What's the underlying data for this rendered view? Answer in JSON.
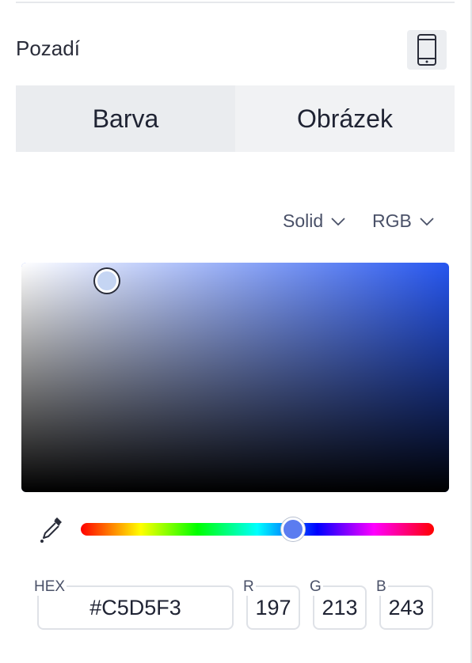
{
  "panel": {
    "section_title": "Pozadí",
    "device_icon": "mobile-phone-icon"
  },
  "tabs": [
    {
      "label": "Barva",
      "active": true
    },
    {
      "label": "Obrázek",
      "active": false
    }
  ],
  "picker": {
    "mode_dropdown": {
      "value": "Solid",
      "icon": "chevron-down-icon"
    },
    "format_dropdown": {
      "value": "RGB",
      "icon": "chevron-down-icon"
    },
    "hue_color": "#2656F0",
    "saturation_fraction": 0.2,
    "value_fraction": 0.92,
    "hue_fraction": 0.6,
    "eyedropper_icon": "eyedropper-icon"
  },
  "fields": {
    "hex": {
      "label": "HEX",
      "value": "#C5D5F3"
    },
    "r": {
      "label": "R",
      "value": "197"
    },
    "g": {
      "label": "G",
      "value": "213"
    },
    "b": {
      "label": "B",
      "value": "243"
    }
  },
  "colors": {
    "selected": "#C5D5F3",
    "tab_active_bg": "#EAECEF"
  }
}
